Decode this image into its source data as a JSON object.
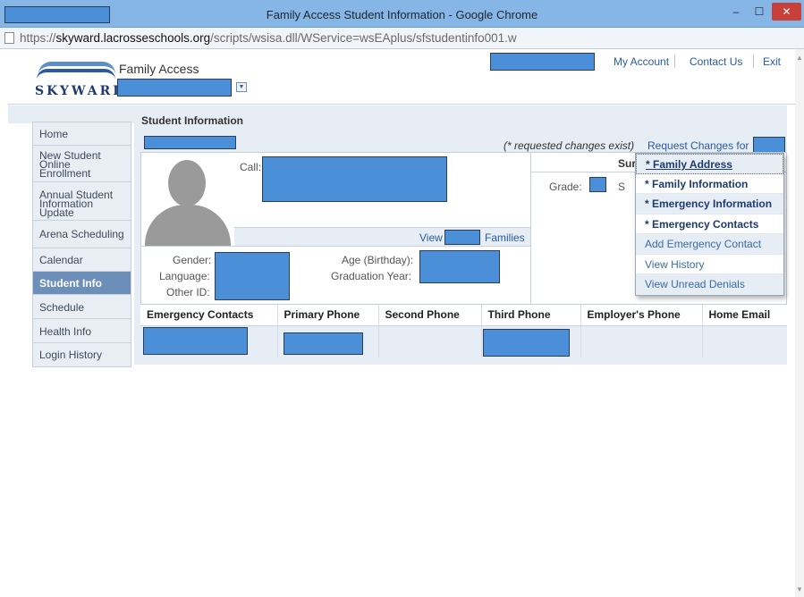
{
  "window": {
    "title": "Family Access Student Information - Google Chrome",
    "minimize": "‒",
    "maximize": "☐",
    "close": "✕"
  },
  "address": {
    "scheme_host_prefix": "https://",
    "host": "skyward.lacrosseschools.org",
    "path": "/scripts/wsisa.dll/WService=wsEAplus/sfstudentinfo001.w"
  },
  "header": {
    "logo_text": "SKYWARD",
    "app_title": "Family Access",
    "dropdown_glyph": "▼"
  },
  "topnav": {
    "my_account": "My Account",
    "contact_us": "Contact Us",
    "exit": "Exit"
  },
  "sidebar": {
    "items": [
      {
        "label": "Home"
      },
      {
        "label": "New Student Online Enrollment"
      },
      {
        "label": "Annual Student Information Update"
      },
      {
        "label": "Arena Scheduling"
      },
      {
        "label": "Calendar"
      },
      {
        "label": "Student Info",
        "active": true
      },
      {
        "label": "Schedule"
      },
      {
        "label": "Health Info"
      },
      {
        "label": "Login History"
      }
    ]
  },
  "main": {
    "heading": "Student Information",
    "requested_note": "(* requested changes exist)",
    "request_link": "Request Changes for",
    "call_label": "Call:",
    "view_label": "View",
    "families_label": "Families",
    "summary_fragment": "Sur",
    "grade_label": "Grade:",
    "s_fragment": "S",
    "gender_label": "Gender:",
    "language_label": "Language:",
    "other_id_label": "Other ID:",
    "age_label": "Age (Birthday):",
    "graduation_label": "Graduation Year:"
  },
  "contacts_table": {
    "columns": [
      "Emergency Contacts",
      "Primary Phone",
      "Second Phone",
      "Third Phone",
      "Employer's Phone",
      "Home Email"
    ]
  },
  "request_menu": {
    "items": [
      "* Family Address",
      "* Family Information",
      "* Emergency Information",
      "* Emergency Contacts",
      "Add Emergency Contact",
      "View History",
      "View Unread Denials"
    ]
  },
  "colors": {
    "redaction": "#4a8fd8",
    "active_nav": "#6b8fb8",
    "link": "#2a5aa3",
    "panel": "#e6edf5"
  }
}
